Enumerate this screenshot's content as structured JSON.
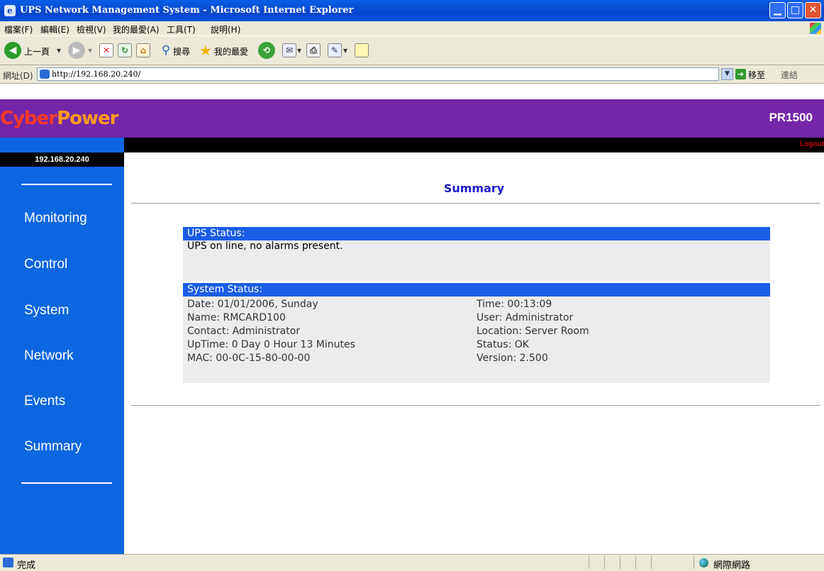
{
  "window": {
    "title": "UPS Network Management System - Microsoft Internet Explorer",
    "minimize_glyph": "▁",
    "maximize_glyph": "□",
    "close_glyph": "✕"
  },
  "menu": {
    "items": [
      "檔案(F)",
      "編輯(E)",
      "檢視(V)",
      "我的最愛(A)",
      "工具(T)",
      "說明(H)"
    ]
  },
  "toolbar": {
    "back_label": "上一頁",
    "search_label": "搜尋",
    "favorites_label": "我的最愛"
  },
  "address": {
    "label": "網址(D)",
    "url": "http://192.168.20.240/",
    "go_label": "移至",
    "links_label": "連結"
  },
  "page": {
    "logo_part1": "Cyber",
    "logo_part2": "Power",
    "model": "PR1500",
    "logout": "Logout",
    "ip": "192.168.20.240",
    "nav": [
      "Monitoring",
      "Control",
      "System",
      "Network",
      "Events",
      "Summary"
    ],
    "title": "Summary",
    "ups_status": {
      "header": "UPS Status:",
      "text": "UPS on line, no alarms present."
    },
    "system_status": {
      "header": "System Status:",
      "left": [
        "Date: 01/01/2006, Sunday",
        "Name: RMCARD100",
        "Contact: Administrator",
        "UpTime: 0 Day 0 Hour 13 Minutes",
        "MAC: 00-0C-15-80-00-00"
      ],
      "right": [
        "Time: 00:13:09",
        "User: Administrator",
        "Location: Server Room",
        "Status: OK",
        "Version: 2.500"
      ]
    }
  },
  "statusbar": {
    "text": "完成",
    "zone": "網際網路"
  }
}
